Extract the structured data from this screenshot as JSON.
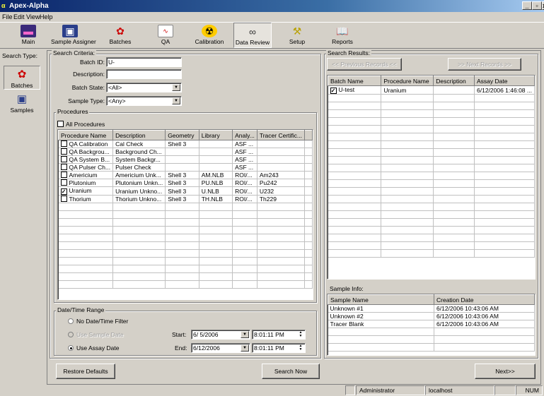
{
  "window": {
    "title": "Apex-Alpha",
    "controls": [
      "_",
      "3",
      "x"
    ]
  },
  "menu": [
    "File",
    "Edit",
    "View",
    "Help"
  ],
  "toolbar": [
    {
      "label": "Main",
      "icon": "main-icon"
    },
    {
      "label": "Sample Assigner",
      "icon": "sample-assigner-icon"
    },
    {
      "label": "Batches",
      "icon": "batches-icon"
    },
    {
      "label": "QA",
      "icon": "qa-chart-icon"
    },
    {
      "label": "Calibration",
      "icon": "radiation-icon"
    },
    {
      "label": "Data Review",
      "icon": "binoculars-icon"
    },
    {
      "label": "Setup",
      "icon": "setup-icon"
    },
    {
      "label": "Reports",
      "icon": "reports-icon"
    }
  ],
  "leftnav": {
    "title": "Search Type:",
    "items": [
      {
        "label": "Batches"
      },
      {
        "label": "Samples"
      }
    ]
  },
  "criteria": {
    "group_label": "Search Criteria:",
    "batch_id_label": "Batch ID:",
    "batch_id_value": "U-",
    "description_label": "Description:",
    "description_value": "",
    "batch_state_label": "Batch State:",
    "batch_state_value": "<All>",
    "sample_type_label": "Sample Type:",
    "sample_type_value": "<Any>"
  },
  "procedures": {
    "group_label": "Procedures",
    "all_label": "All Procedures",
    "columns": [
      "Procedure Name",
      "Description",
      "Geometry",
      "Library",
      "Analy...",
      "Tracer Certific..."
    ],
    "rows": [
      {
        "checked": false,
        "cells": [
          "QA Calibration",
          "Cal Check",
          "Shell 3",
          "",
          "ASF ...",
          ""
        ]
      },
      {
        "checked": false,
        "cells": [
          "QA Backgrou...",
          "Background Ch...",
          "",
          "",
          "ASF ...",
          ""
        ]
      },
      {
        "checked": false,
        "cells": [
          "QA System B...",
          "System Backgr...",
          "",
          "",
          "ASF ...",
          ""
        ]
      },
      {
        "checked": false,
        "cells": [
          "QA Pulser Ch...",
          "Pulser Check",
          "",
          "",
          "ASF ...",
          ""
        ]
      },
      {
        "checked": false,
        "cells": [
          "Americium",
          "Americium Unk...",
          "Shell 3",
          "AM.NLB",
          "ROI/...",
          "Am243"
        ]
      },
      {
        "checked": false,
        "cells": [
          "Plutonium",
          "Plutonium Unkn...",
          "Shell 3",
          "PU.NLB",
          "ROI/...",
          "Pu242"
        ]
      },
      {
        "checked": true,
        "cells": [
          "Uranium",
          "Uranium Unkno...",
          "Shell 3",
          "U.NLB",
          "ROI/...",
          "U232"
        ]
      },
      {
        "checked": false,
        "cells": [
          "Thorium",
          "Thorium Unkno...",
          "Shell 3",
          "TH.NLB",
          "ROI/...",
          "Th229"
        ]
      }
    ]
  },
  "daterange": {
    "group_label": "Date/Time Range",
    "opt_none": "No Date/Time Filter",
    "opt_sample": "Use Sample Date",
    "opt_assay": "Use Assay Date",
    "start_label": "Start:",
    "start_date": "6/ 5/2006",
    "start_time": "8:01:11 PM",
    "end_label": "End:",
    "end_date": "6/12/2006",
    "end_time": "8:01:11 PM"
  },
  "buttons": {
    "restore": "Restore Defaults",
    "search": "Search Now",
    "next": "Next>>",
    "prev_records": "<< Previous Records <<",
    "next_records": ">> Next Records >>"
  },
  "results": {
    "group_label": "Search Results:",
    "columns": [
      "Batch Name",
      "Procedure Name",
      "Description",
      "Assay Date"
    ],
    "rows": [
      {
        "checked": true,
        "cells": [
          "U-test",
          "Uranium",
          "",
          "6/12/2006 1:46:08 ..."
        ]
      }
    ]
  },
  "sample_info": {
    "label": "Sample Info:",
    "columns": [
      "Sample Name",
      "Creation Date"
    ],
    "rows": [
      [
        "Unknown #1",
        "6/12/2006 10:43:06 AM"
      ],
      [
        "Unknown #2",
        "6/12/2006 10:43:06 AM"
      ],
      [
        "Tracer Blank",
        "6/12/2006 10:43:06 AM"
      ]
    ]
  },
  "status": {
    "user": "Administrator",
    "host": "localhost",
    "num": "NUM"
  }
}
